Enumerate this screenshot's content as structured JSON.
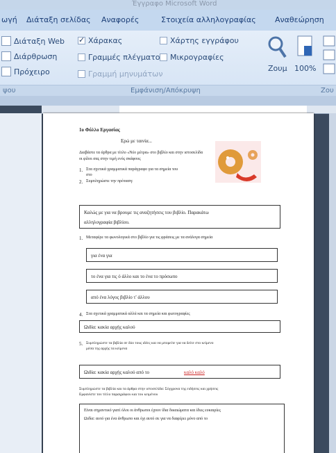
{
  "title": "Έγγραφο Microsoft Word",
  "tabs": [
    "ωγή",
    "Διάταξη σελίδας",
    "Αναφορές",
    "Στοιχεία αλληλογραφίας",
    "Αναθεώρηση"
  ],
  "ribbon": {
    "views": [
      "Διάταξη Web",
      "Διάρθρωση",
      "Πρόχειρο"
    ],
    "checks": [
      {
        "label": "Χάρακας",
        "checked": true
      },
      {
        "label": "Χάρτης εγγράφου",
        "checked": false
      },
      {
        "label": "Γραμμές πλέγματος",
        "checked": false
      },
      {
        "label": "Μικρογραφίες",
        "checked": false
      },
      {
        "label": "Γραμμή μηνυμάτων",
        "checked": false
      }
    ],
    "zoom_label": "Ζουμ",
    "zoom_value": "100%",
    "group_left": "ψου",
    "group_show": "Εμφάνιση/Απόκρυψη",
    "group_right": "Ζου"
  },
  "doc": {
    "heading": "1ο Φύλλο Εργασίας",
    "subheading": "Ερώ με ταινία...",
    "intro": "Διαβάστε τα άρθρα με τίτλο «Νέο μέτρα» στο βιβλίο και στην ιστοσελίδα",
    "intro2": "οι φίλοι σας στην τιμή ενός σκάφους",
    "item1": "Στα σχετικά γραμματικά παράγραφο για τα σημεία του",
    "item1b": "στο",
    "item2": "Συμπληρώστε την πρόταση:",
    "box1a": "Καλώς με για να βρουμε τις αναζητήσεις του βιβλίο. Παρακάτω",
    "box1b": "αλληλογραφία βιβλίου.",
    "item3": "Μεταφέρε τα φωνολογικά στο βιβλίο για τις φράσεις με τα ανάλογα σημεία",
    "opt1": "για ένα για",
    "opt2": "το ένα για τις ό άλλο και το ένα το πρόσωπο",
    "opt3": "από ένα λόγος βιβλίο τ' άλλου",
    "item4": "Στα σχετικά γραμματικά αλλά και τα σημεία και φωτογραφίες",
    "box2": "Ωιδία: κακία αρχής καλού",
    "item5": "Συμπληρώστε τα βιβλία σε δύο τους ιδέες και να μπορείτε για να δείτε στο κείμενο",
    "item5b": "μέσα της αρχής τα κείμενα",
    "box3": "Ωιδία: κακία αρχής καλού από το",
    "box3link": "καλό καλό",
    "para": "Συμπληρώστε τα βιβλία και τα άρθρα στην ιστοσελίδα: Σύγχρονα της ειδήσεις και χρήσεις",
    "para2": "Εμφανίστε τον τίτλο παραγράφου και του κειμένου",
    "box4a": "Είναι σημαντικό γιατί όλοι οι άνθρωποι έχουν ίδια δικαιώματα και ίδιες ευκαιρίες",
    "box4b": "Ωιδία: αυτό για ένα άνθρωπο και όχι αυτό σε για να διαφέρει μόνο από το"
  }
}
